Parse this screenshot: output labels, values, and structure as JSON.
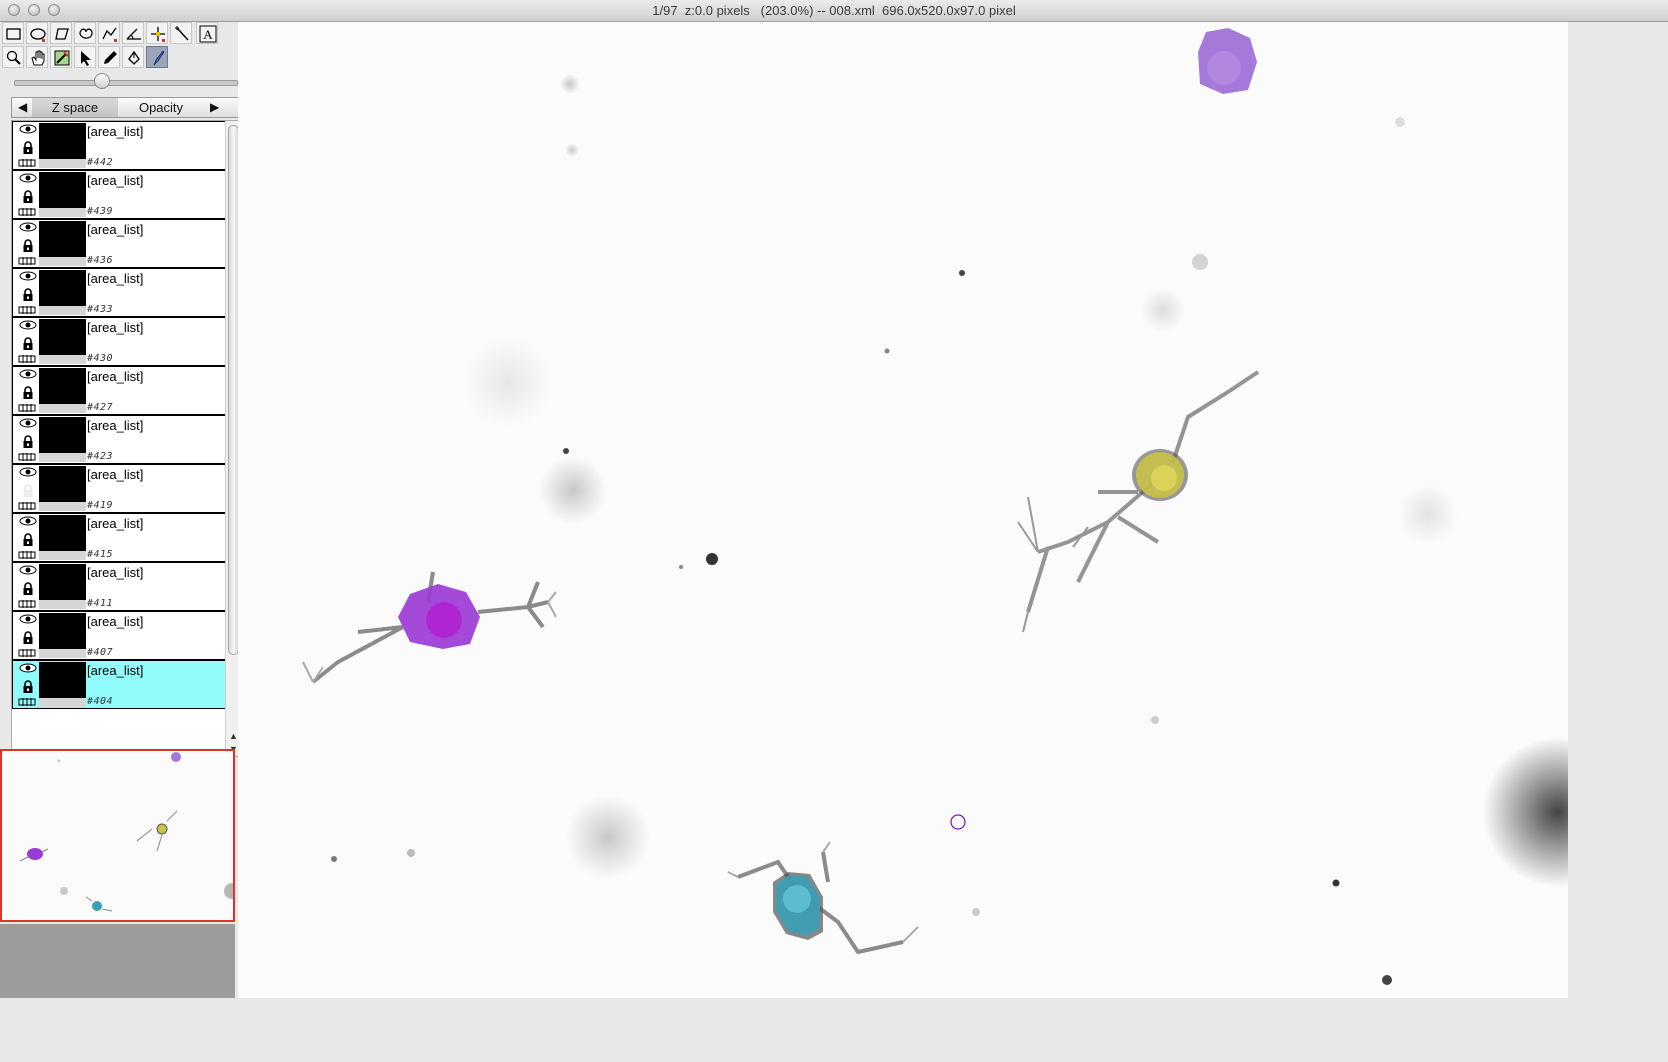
{
  "window": {
    "title": "1/97  z:0.0 pixels   (203.0%) -- 008.xml  696.0x520.0x97.0 pixel"
  },
  "toolbar": {
    "tools": [
      "rectangle-tool",
      "oval-tool",
      "polygon-tool",
      "freehand-tool",
      "line-tool",
      "angle-tool",
      "point-tool",
      "wand-tool",
      "text-tool",
      "zoom-tool",
      "hand-tool",
      "pick-tool",
      "select-tool",
      "pencil-tool",
      "fill-tool",
      "brush-tool"
    ],
    "active_tool": "brush-tool"
  },
  "tabs": {
    "items": [
      "Z space",
      "Opacity"
    ],
    "selected": "Z space"
  },
  "layers": [
    {
      "label": "[area_list]",
      "id": "#442",
      "locked": true,
      "selected": false
    },
    {
      "label": "[area_list]",
      "id": "#439",
      "locked": true,
      "selected": false
    },
    {
      "label": "[area_list]",
      "id": "#436",
      "locked": true,
      "selected": false
    },
    {
      "label": "[area_list]",
      "id": "#433",
      "locked": true,
      "selected": false
    },
    {
      "label": "[area_list]",
      "id": "#430",
      "locked": true,
      "selected": false
    },
    {
      "label": "[area_list]",
      "id": "#427",
      "locked": true,
      "selected": false
    },
    {
      "label": "[area_list]",
      "id": "#423",
      "locked": true,
      "selected": false
    },
    {
      "label": "[area_list]",
      "id": "#419",
      "locked": false,
      "selected": false
    },
    {
      "label": "[area_list]",
      "id": "#415",
      "locked": true,
      "selected": false
    },
    {
      "label": "[area_list]",
      "id": "#411",
      "locked": true,
      "selected": false
    },
    {
      "label": "[area_list]",
      "id": "#407",
      "locked": true,
      "selected": false
    },
    {
      "label": "[area_list]",
      "id": "#404",
      "locked": true,
      "selected": true
    }
  ],
  "colors": {
    "selection_highlight": "#92fbfb",
    "navigator_border": "#d8362c",
    "cell_purple": "#9b3bd6",
    "cell_magenta": "#b21fd0",
    "cell_yellow": "#c9c24a",
    "cell_teal": "#3aa0b4",
    "cursor_ring": "#7a1fd0"
  }
}
